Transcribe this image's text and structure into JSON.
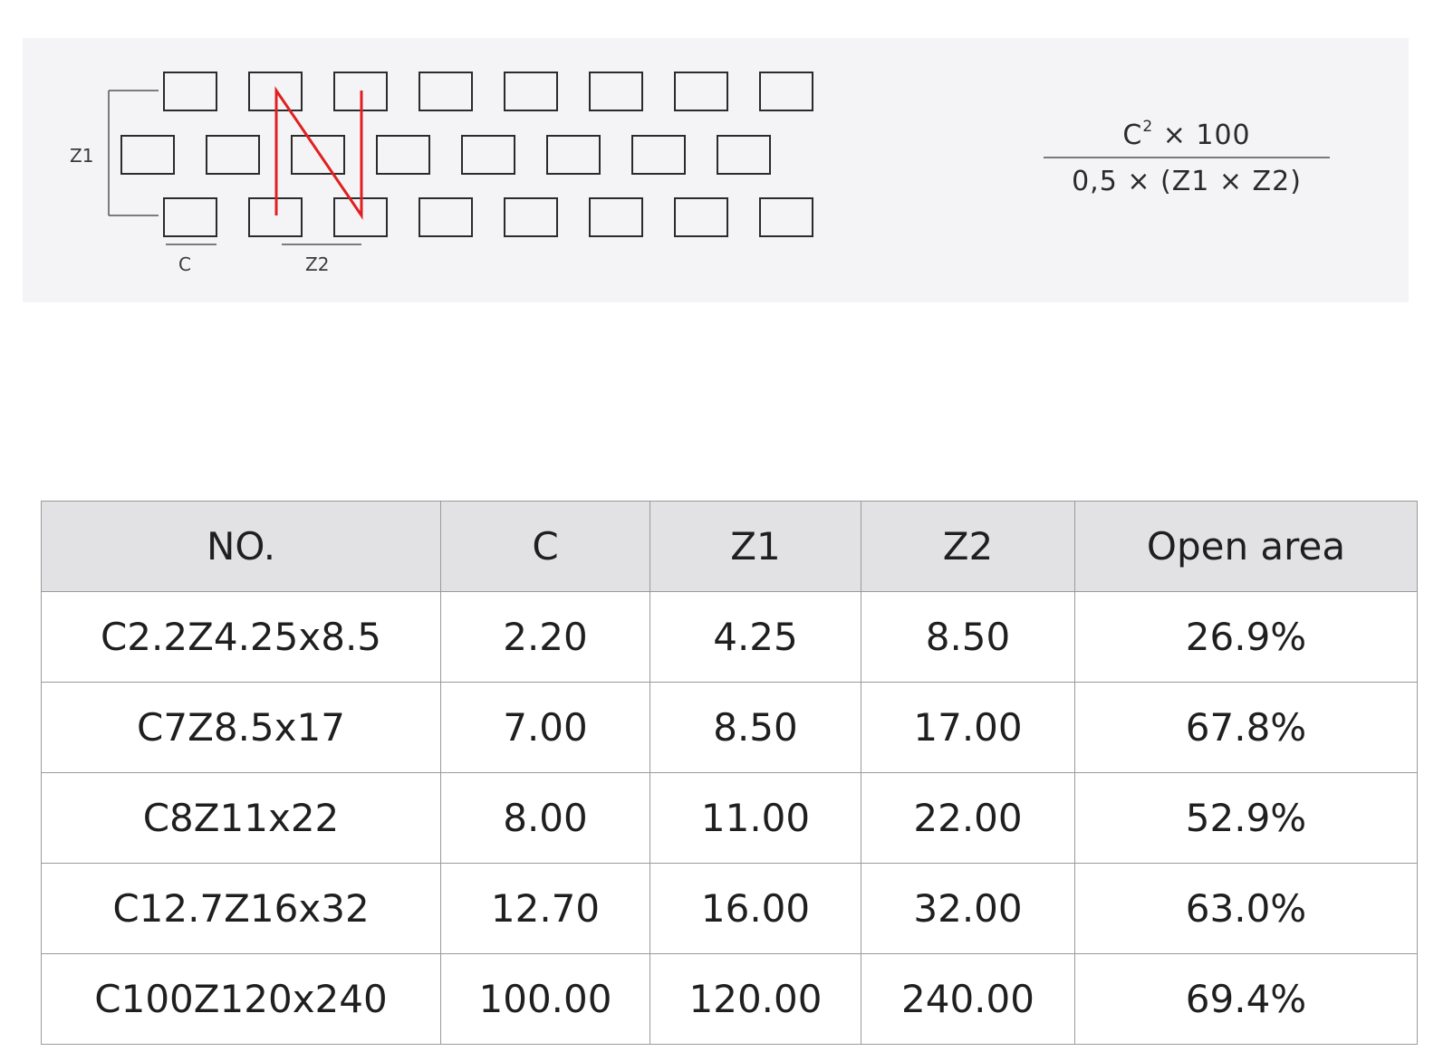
{
  "diagram": {
    "labels": {
      "c": "C",
      "z1": "Z1",
      "z2": "Z2"
    },
    "accent_color": "#e02020",
    "formula": {
      "numerator": "C",
      "numerator_exp": "2",
      "numerator_rest": "× 100",
      "denominator": "0,5 × (Z1 × Z2)"
    }
  },
  "table": {
    "headers": [
      "NO.",
      "C",
      "Z1",
      "Z2",
      "Open area"
    ],
    "rows": [
      [
        "C2.2Z4.25x8.5",
        "2.20",
        "4.25",
        "8.50",
        "26.9%"
      ],
      [
        "C7Z8.5x17",
        "7.00",
        "8.50",
        "17.00",
        "67.8%"
      ],
      [
        "C8Z11x22",
        "8.00",
        "11.00",
        "22.00",
        "52.9%"
      ],
      [
        "C12.7Z16x32",
        "12.70",
        "16.00",
        "32.00",
        "63.0%"
      ],
      [
        "C100Z120x240",
        "100.00",
        "120.00",
        "240.00",
        "69.4%"
      ]
    ]
  }
}
